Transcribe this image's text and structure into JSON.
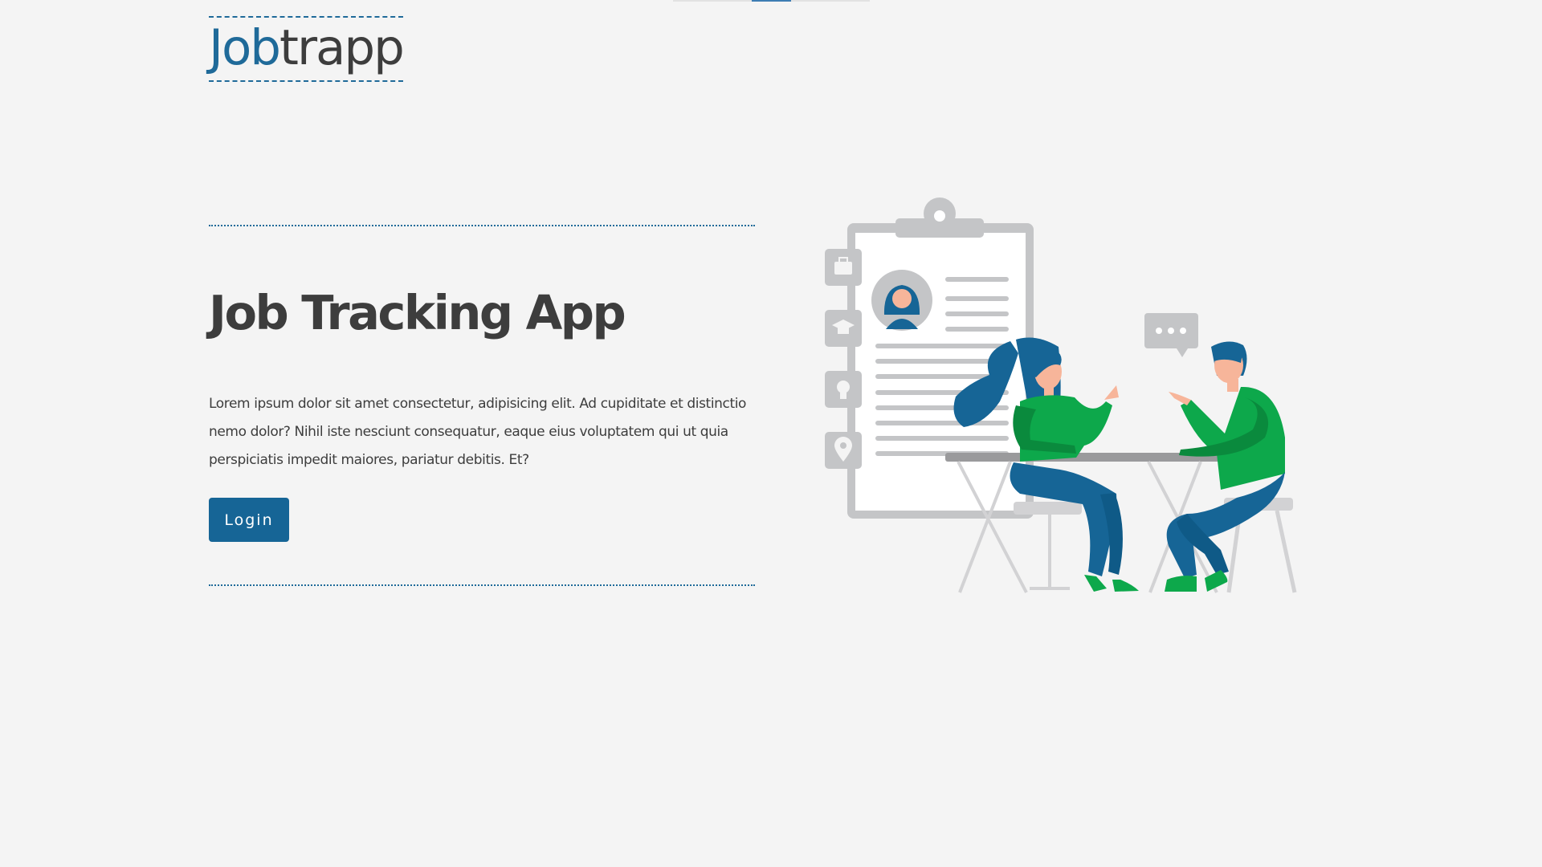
{
  "header": {
    "logo_part1": "Job",
    "logo_part2": "trapp"
  },
  "hero": {
    "title": "Job Tracking App",
    "description": "Lorem ipsum dolor sit amet consectetur, adipisicing elit. Ad cupiditate et distinctio nemo dolor? Nihil iste nesciunt consequatur, eaque eius voluptatem qui ut quia perspiciatis impedit maiores, pariatur debitis. Et?",
    "login_label": "Login"
  },
  "colors": {
    "background": "#f4f4f4",
    "brand_blue": "#166596",
    "text": "#3d3d3d",
    "illustration_green": "#0da84b",
    "illustration_gray": "#c4c5c7"
  },
  "illustration": {
    "icons": [
      "briefcase-icon",
      "graduation-cap-icon",
      "lightbulb-icon",
      "location-pin-icon",
      "chat-bubble-icon",
      "avatar-icon"
    ]
  }
}
